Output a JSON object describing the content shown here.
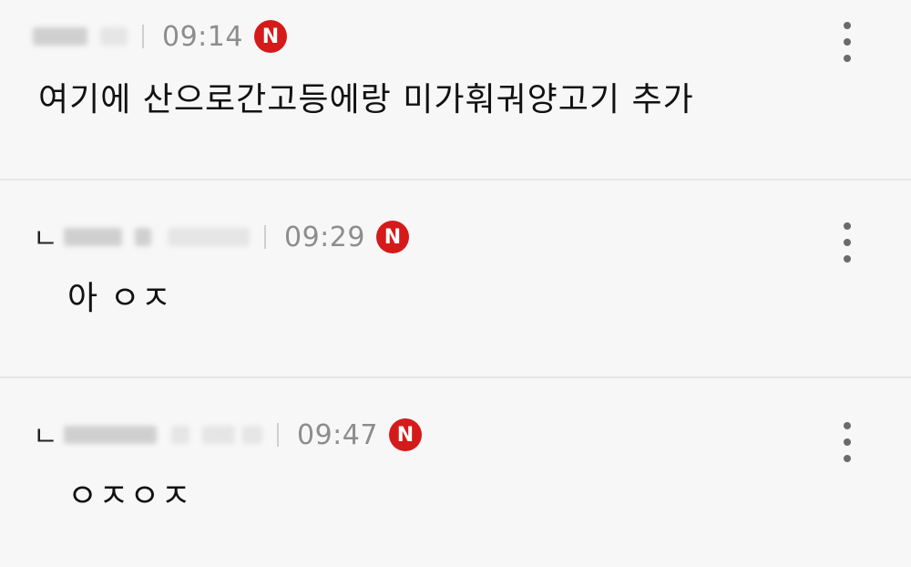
{
  "comments": [
    {
      "reply_marker": "",
      "time": "09:14",
      "badge": "N",
      "text": "여기에 산으로간고등에랑 미가훠궈양고기 추가"
    },
    {
      "reply_marker": "ㄴ",
      "time": "09:29",
      "badge": "N",
      "text": "아 ㅇㅈ"
    },
    {
      "reply_marker": "ㄴ",
      "time": "09:47",
      "badge": "N",
      "text": "ㅇㅈㅇㅈ"
    }
  ],
  "colors": {
    "background": "#f7f7f7",
    "badge": "#d51a1a",
    "time": "#8d8d8d",
    "divider": "#e6e6e6"
  },
  "icons": {
    "more": "more-vertical-icon",
    "badge": "new-badge-icon"
  }
}
